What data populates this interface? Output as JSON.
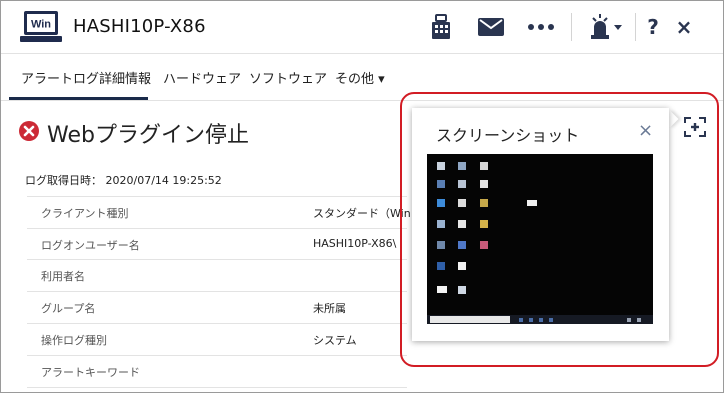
{
  "header": {
    "logo_text": "Win",
    "hostname": "HASHI10P-X86",
    "icons": [
      "building-icon",
      "mail-icon",
      "more-icon",
      "alarm-icon",
      "help-icon",
      "close-icon"
    ]
  },
  "tabs": [
    {
      "label": "アラートログ詳細情報",
      "active": true
    },
    {
      "label": "ハードウェア",
      "active": false
    },
    {
      "label": "ソフトウェア",
      "active": false
    },
    {
      "label": "その他 ▾",
      "active": false
    }
  ],
  "alert": {
    "title": "Webプラグイン停止",
    "log_time": "ログ取得日時： 2020/07/14 19:25:52",
    "status_color": "#cc2a36"
  },
  "details": [
    {
      "label": "クライアント種別",
      "value": "スタンダード（Win"
    },
    {
      "label": "ログオンユーザー名",
      "value": "HASHI10P-X86\\"
    },
    {
      "label": "利用者名",
      "value": ""
    },
    {
      "label": "グループ名",
      "value": "未所属"
    },
    {
      "label": "操作ログ種別",
      "value": "システム"
    },
    {
      "label": "アラートキーワード",
      "value": ""
    }
  ],
  "popup": {
    "title": "スクリーンショット",
    "close_symbol": "×",
    "highlight_color": "#d21c24"
  }
}
